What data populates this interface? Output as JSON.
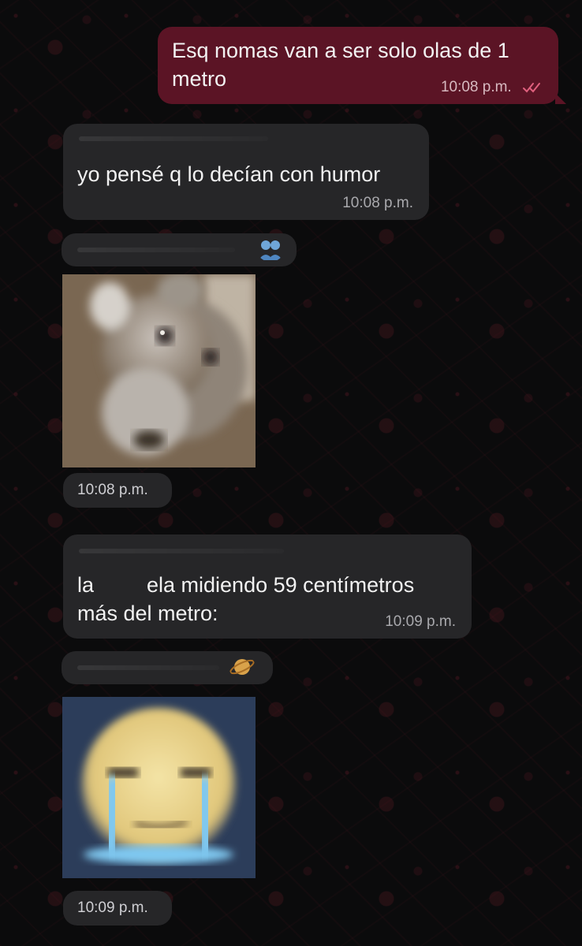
{
  "messages": [
    {
      "id": "m1",
      "direction": "outgoing",
      "text_line1": "Esq nomas van a ser solo olas de 1",
      "text_line2": "metro",
      "time": "10:08 p.m.",
      "status_icon": "double-check-icon"
    },
    {
      "id": "m2",
      "direction": "incoming",
      "text": "yo pensé q lo decían con humor",
      "time": "10:08 p.m."
    },
    {
      "id": "m3",
      "direction": "incoming",
      "type": "image",
      "image": "blurry-dog-meme",
      "sender_emoji": "people-hugging-emoji",
      "time": "10:08 p.m."
    },
    {
      "id": "m4",
      "direction": "incoming",
      "text_line1_a": "la",
      "text_line1_b": "ela midiendo 59 centímetros",
      "text_line2": "más del metro:",
      "time": "10:09 p.m."
    },
    {
      "id": "m5",
      "direction": "incoming",
      "type": "image",
      "image": "crying-emoji-face-meme",
      "sender_emoji": "ringed-planet-emoji",
      "time": "10:09 p.m."
    }
  ],
  "colors": {
    "outgoing": "#5b1425",
    "incoming": "#262628",
    "read_check": "#e0607e"
  }
}
